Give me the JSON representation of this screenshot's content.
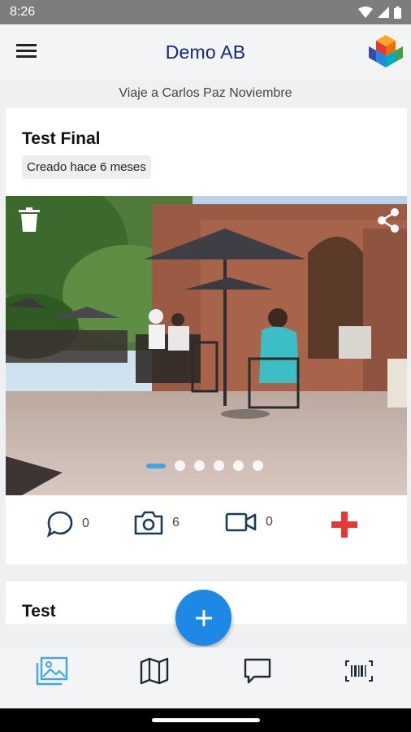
{
  "status_bar": {
    "time": "8:26"
  },
  "app_bar": {
    "title": "Demo AB"
  },
  "subtitle": "Viaje a Carlos Paz Noviembre",
  "posts": [
    {
      "title": "Test Final",
      "created": "Creado hace 6 meses",
      "comments_count": "0",
      "photos_count": "6",
      "videos_count": "0",
      "carousel_pages": 6,
      "carousel_active": 1
    },
    {
      "title": "Test"
    }
  ],
  "colors": {
    "accent": "#1e88e5",
    "title": "#1a237e",
    "add": "#e53935",
    "icon": "#1a3a5c"
  },
  "bottom_nav": [
    "gallery-icon",
    "map-icon",
    "chat-icon",
    "barcode-icon"
  ]
}
